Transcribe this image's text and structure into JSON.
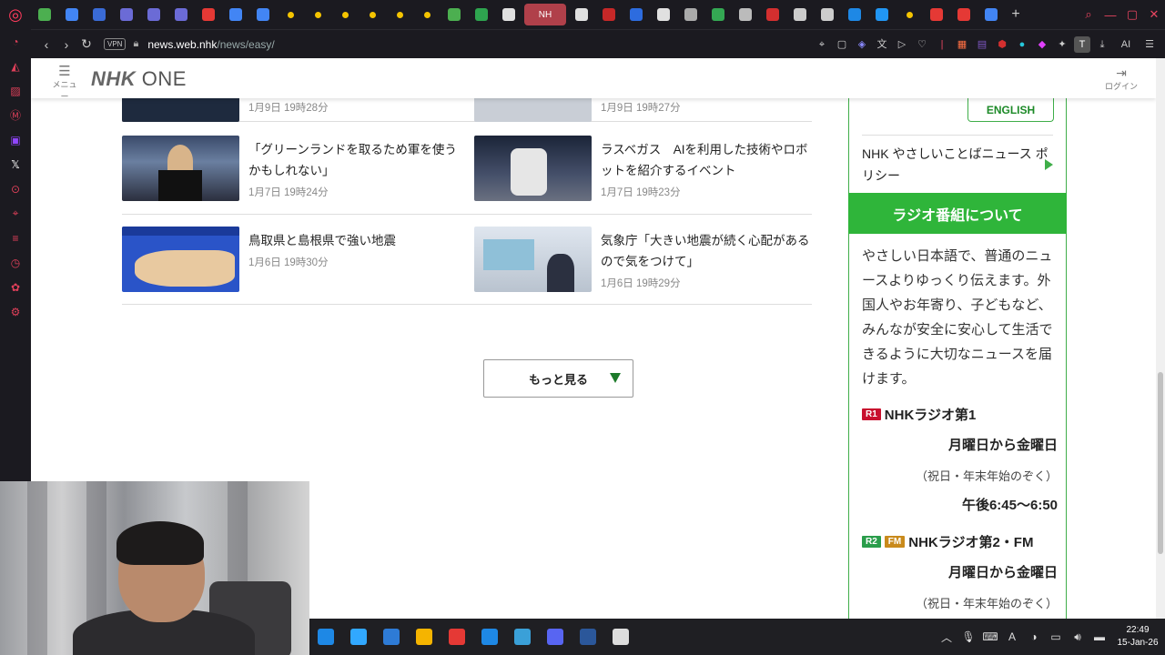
{
  "browser": {
    "tab_active_label": "NH",
    "new_tab": "+",
    "url_host": "news.web.nhk",
    "url_path": "/news/easy/",
    "vpn_label": "VPN",
    "ai_label": "AI",
    "tab_colors": [
      "#4caf50",
      "#4285f4",
      "#3a6bd6",
      "#6b6bd6",
      "#6b6bd6",
      "#6b6bd6",
      "#e53935",
      "#4285f4",
      "#4285f4",
      "#f5c400",
      "#f5c400",
      "#f5c400",
      "#f5c400",
      "#f5c400",
      "#f5c400",
      "#4caf50",
      "#2ea44f",
      "#e0e0e0"
    ],
    "tab_colors_after": [
      "#e0e0e0",
      "#c62828",
      "#2d6cdf",
      "#e0e0e0",
      "#aaaaaa",
      "#34a853",
      "#bbbbbb",
      "#d32f2f",
      "#cccccc",
      "#cccccc",
      "#1e88e5",
      "#2196f3",
      "#f5c400",
      "#e53935",
      "#e53935",
      "#4285f4"
    ]
  },
  "header": {
    "menu_label": "メニュー",
    "brand_nhk": "NHK",
    "brand_one": "ONE",
    "login_label": "ログイン"
  },
  "news": [
    {
      "title": "",
      "date": "1月9日 19時28分"
    },
    {
      "title": "",
      "date": "1月9日 19時27分"
    },
    {
      "title": "「グリーンランドを取るため軍を使うかもしれない」",
      "date": "1月7日 19時24分"
    },
    {
      "title": "ラスベガス　AIを利用した技術やロボットを紹介するイベント",
      "date": "1月7日 19時23分"
    },
    {
      "title": "鳥取県と島根県で強い地震",
      "date": "1月6日 19時30分"
    },
    {
      "title": "気象庁「大きい地震が続く心配があるので気をつけて」",
      "date": "1月6日 19時29分"
    }
  ],
  "more_button": "もっと見る",
  "right_panel": {
    "english": "ENGLISH",
    "policy": "NHK やさしいことばニュース ポリシー",
    "radio_header": "ラジオ番組について",
    "radio_desc": "やさしい日本語で、普通のニュースよりゆっくり伝えます。外国人やお年寄り、子どもなど、みんなが安全に安心して生活できるように大切なニュースを届けます。",
    "stations": [
      {
        "badges": [
          {
            "text": "R1",
            "color": "#c8102e"
          }
        ],
        "name": "NHKラジオ第1",
        "days": "月曜日から金曜日",
        "holiday": "（祝日・年末年始のぞく）",
        "time": "午後6:45〜6:50"
      },
      {
        "badges": [
          {
            "text": "R2",
            "color": "#2a9d4b"
          },
          {
            "text": "FM",
            "color": "#c98a1b"
          }
        ],
        "name": "NHKラジオ第2・FM",
        "days": "月曜日から金曜日",
        "holiday": "（祝日・年末年始のぞく）",
        "time": ""
      }
    ]
  },
  "taskbar": {
    "app_colors": [
      "#1e88e5",
      "#31a8ff",
      "#2e7bd6",
      "#f5b400",
      "#e53935",
      "#1e88e5",
      "#3aa0d8",
      "#5865f2",
      "#2b579a",
      "#dddddd"
    ],
    "time": "22:49",
    "date": "15-Jan-26"
  }
}
